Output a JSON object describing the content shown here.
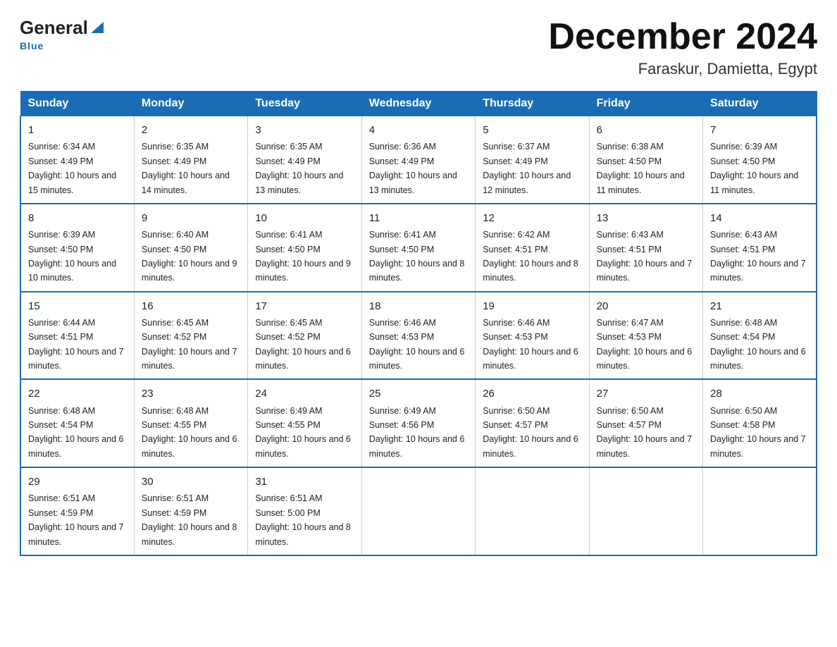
{
  "logo": {
    "general": "General",
    "blue": "Blue"
  },
  "title": "December 2024",
  "subtitle": "Faraskur, Damietta, Egypt",
  "weekdays": [
    "Sunday",
    "Monday",
    "Tuesday",
    "Wednesday",
    "Thursday",
    "Friday",
    "Saturday"
  ],
  "weeks": [
    [
      {
        "day": "1",
        "sunrise": "Sunrise: 6:34 AM",
        "sunset": "Sunset: 4:49 PM",
        "daylight": "Daylight: 10 hours and 15 minutes."
      },
      {
        "day": "2",
        "sunrise": "Sunrise: 6:35 AM",
        "sunset": "Sunset: 4:49 PM",
        "daylight": "Daylight: 10 hours and 14 minutes."
      },
      {
        "day": "3",
        "sunrise": "Sunrise: 6:35 AM",
        "sunset": "Sunset: 4:49 PM",
        "daylight": "Daylight: 10 hours and 13 minutes."
      },
      {
        "day": "4",
        "sunrise": "Sunrise: 6:36 AM",
        "sunset": "Sunset: 4:49 PM",
        "daylight": "Daylight: 10 hours and 13 minutes."
      },
      {
        "day": "5",
        "sunrise": "Sunrise: 6:37 AM",
        "sunset": "Sunset: 4:49 PM",
        "daylight": "Daylight: 10 hours and 12 minutes."
      },
      {
        "day": "6",
        "sunrise": "Sunrise: 6:38 AM",
        "sunset": "Sunset: 4:50 PM",
        "daylight": "Daylight: 10 hours and 11 minutes."
      },
      {
        "day": "7",
        "sunrise": "Sunrise: 6:39 AM",
        "sunset": "Sunset: 4:50 PM",
        "daylight": "Daylight: 10 hours and 11 minutes."
      }
    ],
    [
      {
        "day": "8",
        "sunrise": "Sunrise: 6:39 AM",
        "sunset": "Sunset: 4:50 PM",
        "daylight": "Daylight: 10 hours and 10 minutes."
      },
      {
        "day": "9",
        "sunrise": "Sunrise: 6:40 AM",
        "sunset": "Sunset: 4:50 PM",
        "daylight": "Daylight: 10 hours and 9 minutes."
      },
      {
        "day": "10",
        "sunrise": "Sunrise: 6:41 AM",
        "sunset": "Sunset: 4:50 PM",
        "daylight": "Daylight: 10 hours and 9 minutes."
      },
      {
        "day": "11",
        "sunrise": "Sunrise: 6:41 AM",
        "sunset": "Sunset: 4:50 PM",
        "daylight": "Daylight: 10 hours and 8 minutes."
      },
      {
        "day": "12",
        "sunrise": "Sunrise: 6:42 AM",
        "sunset": "Sunset: 4:51 PM",
        "daylight": "Daylight: 10 hours and 8 minutes."
      },
      {
        "day": "13",
        "sunrise": "Sunrise: 6:43 AM",
        "sunset": "Sunset: 4:51 PM",
        "daylight": "Daylight: 10 hours and 7 minutes."
      },
      {
        "day": "14",
        "sunrise": "Sunrise: 6:43 AM",
        "sunset": "Sunset: 4:51 PM",
        "daylight": "Daylight: 10 hours and 7 minutes."
      }
    ],
    [
      {
        "day": "15",
        "sunrise": "Sunrise: 6:44 AM",
        "sunset": "Sunset: 4:51 PM",
        "daylight": "Daylight: 10 hours and 7 minutes."
      },
      {
        "day": "16",
        "sunrise": "Sunrise: 6:45 AM",
        "sunset": "Sunset: 4:52 PM",
        "daylight": "Daylight: 10 hours and 7 minutes."
      },
      {
        "day": "17",
        "sunrise": "Sunrise: 6:45 AM",
        "sunset": "Sunset: 4:52 PM",
        "daylight": "Daylight: 10 hours and 6 minutes."
      },
      {
        "day": "18",
        "sunrise": "Sunrise: 6:46 AM",
        "sunset": "Sunset: 4:53 PM",
        "daylight": "Daylight: 10 hours and 6 minutes."
      },
      {
        "day": "19",
        "sunrise": "Sunrise: 6:46 AM",
        "sunset": "Sunset: 4:53 PM",
        "daylight": "Daylight: 10 hours and 6 minutes."
      },
      {
        "day": "20",
        "sunrise": "Sunrise: 6:47 AM",
        "sunset": "Sunset: 4:53 PM",
        "daylight": "Daylight: 10 hours and 6 minutes."
      },
      {
        "day": "21",
        "sunrise": "Sunrise: 6:48 AM",
        "sunset": "Sunset: 4:54 PM",
        "daylight": "Daylight: 10 hours and 6 minutes."
      }
    ],
    [
      {
        "day": "22",
        "sunrise": "Sunrise: 6:48 AM",
        "sunset": "Sunset: 4:54 PM",
        "daylight": "Daylight: 10 hours and 6 minutes."
      },
      {
        "day": "23",
        "sunrise": "Sunrise: 6:48 AM",
        "sunset": "Sunset: 4:55 PM",
        "daylight": "Daylight: 10 hours and 6 minutes."
      },
      {
        "day": "24",
        "sunrise": "Sunrise: 6:49 AM",
        "sunset": "Sunset: 4:55 PM",
        "daylight": "Daylight: 10 hours and 6 minutes."
      },
      {
        "day": "25",
        "sunrise": "Sunrise: 6:49 AM",
        "sunset": "Sunset: 4:56 PM",
        "daylight": "Daylight: 10 hours and 6 minutes."
      },
      {
        "day": "26",
        "sunrise": "Sunrise: 6:50 AM",
        "sunset": "Sunset: 4:57 PM",
        "daylight": "Daylight: 10 hours and 6 minutes."
      },
      {
        "day": "27",
        "sunrise": "Sunrise: 6:50 AM",
        "sunset": "Sunset: 4:57 PM",
        "daylight": "Daylight: 10 hours and 7 minutes."
      },
      {
        "day": "28",
        "sunrise": "Sunrise: 6:50 AM",
        "sunset": "Sunset: 4:58 PM",
        "daylight": "Daylight: 10 hours and 7 minutes."
      }
    ],
    [
      {
        "day": "29",
        "sunrise": "Sunrise: 6:51 AM",
        "sunset": "Sunset: 4:59 PM",
        "daylight": "Daylight: 10 hours and 7 minutes."
      },
      {
        "day": "30",
        "sunrise": "Sunrise: 6:51 AM",
        "sunset": "Sunset: 4:59 PM",
        "daylight": "Daylight: 10 hours and 8 minutes."
      },
      {
        "day": "31",
        "sunrise": "Sunrise: 6:51 AM",
        "sunset": "Sunset: 5:00 PM",
        "daylight": "Daylight: 10 hours and 8 minutes."
      },
      null,
      null,
      null,
      null
    ]
  ]
}
